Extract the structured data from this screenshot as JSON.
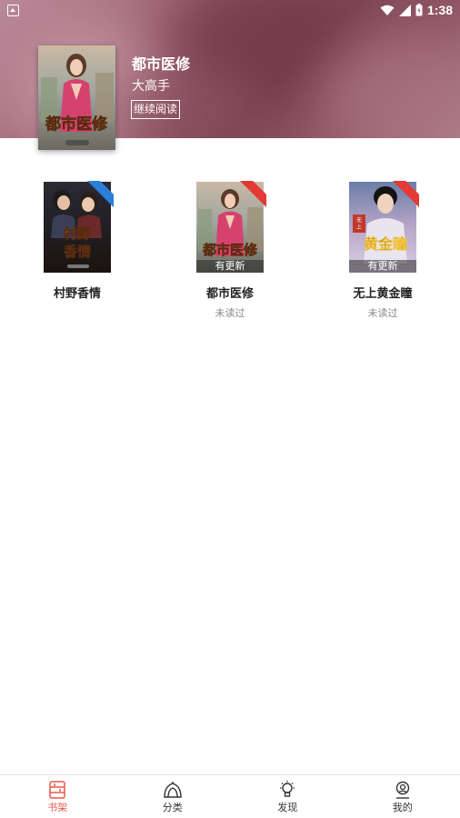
{
  "status_bar": {
    "time": "1:38",
    "icons": [
      "notification-icon",
      "wifi-icon",
      "signal-icon",
      "battery-icon"
    ]
  },
  "current_book": {
    "title": "都市医修",
    "author": "大高手",
    "continue_label": "继续阅读",
    "cover_title": "都市医修"
  },
  "books": [
    {
      "title": "村野香情",
      "status": "",
      "cover_title": "村野香情",
      "badge": "blue",
      "has_update": false,
      "update_label": ""
    },
    {
      "title": "都市医修",
      "status": "未读过",
      "cover_title": "都市医修",
      "badge": "red",
      "has_update": true,
      "update_label": "有更新"
    },
    {
      "title": "无上黄金瞳",
      "status": "未读过",
      "cover_title": "黄金瞳",
      "badge": "red",
      "has_update": true,
      "update_label": "有更新"
    }
  ],
  "bottom_nav": [
    {
      "label": "书架",
      "icon": "bookshelf-icon",
      "active": true
    },
    {
      "label": "分类",
      "icon": "category-icon",
      "active": false
    },
    {
      "label": "发现",
      "icon": "lightbulb-icon",
      "active": false
    },
    {
      "label": "我的",
      "icon": "profile-icon",
      "active": false
    }
  ],
  "colors": {
    "accent": "#e8574a",
    "badge_blue": "#2b7fd6",
    "badge_red": "#e53935",
    "text_primary": "#222222",
    "text_secondary": "#888888"
  }
}
